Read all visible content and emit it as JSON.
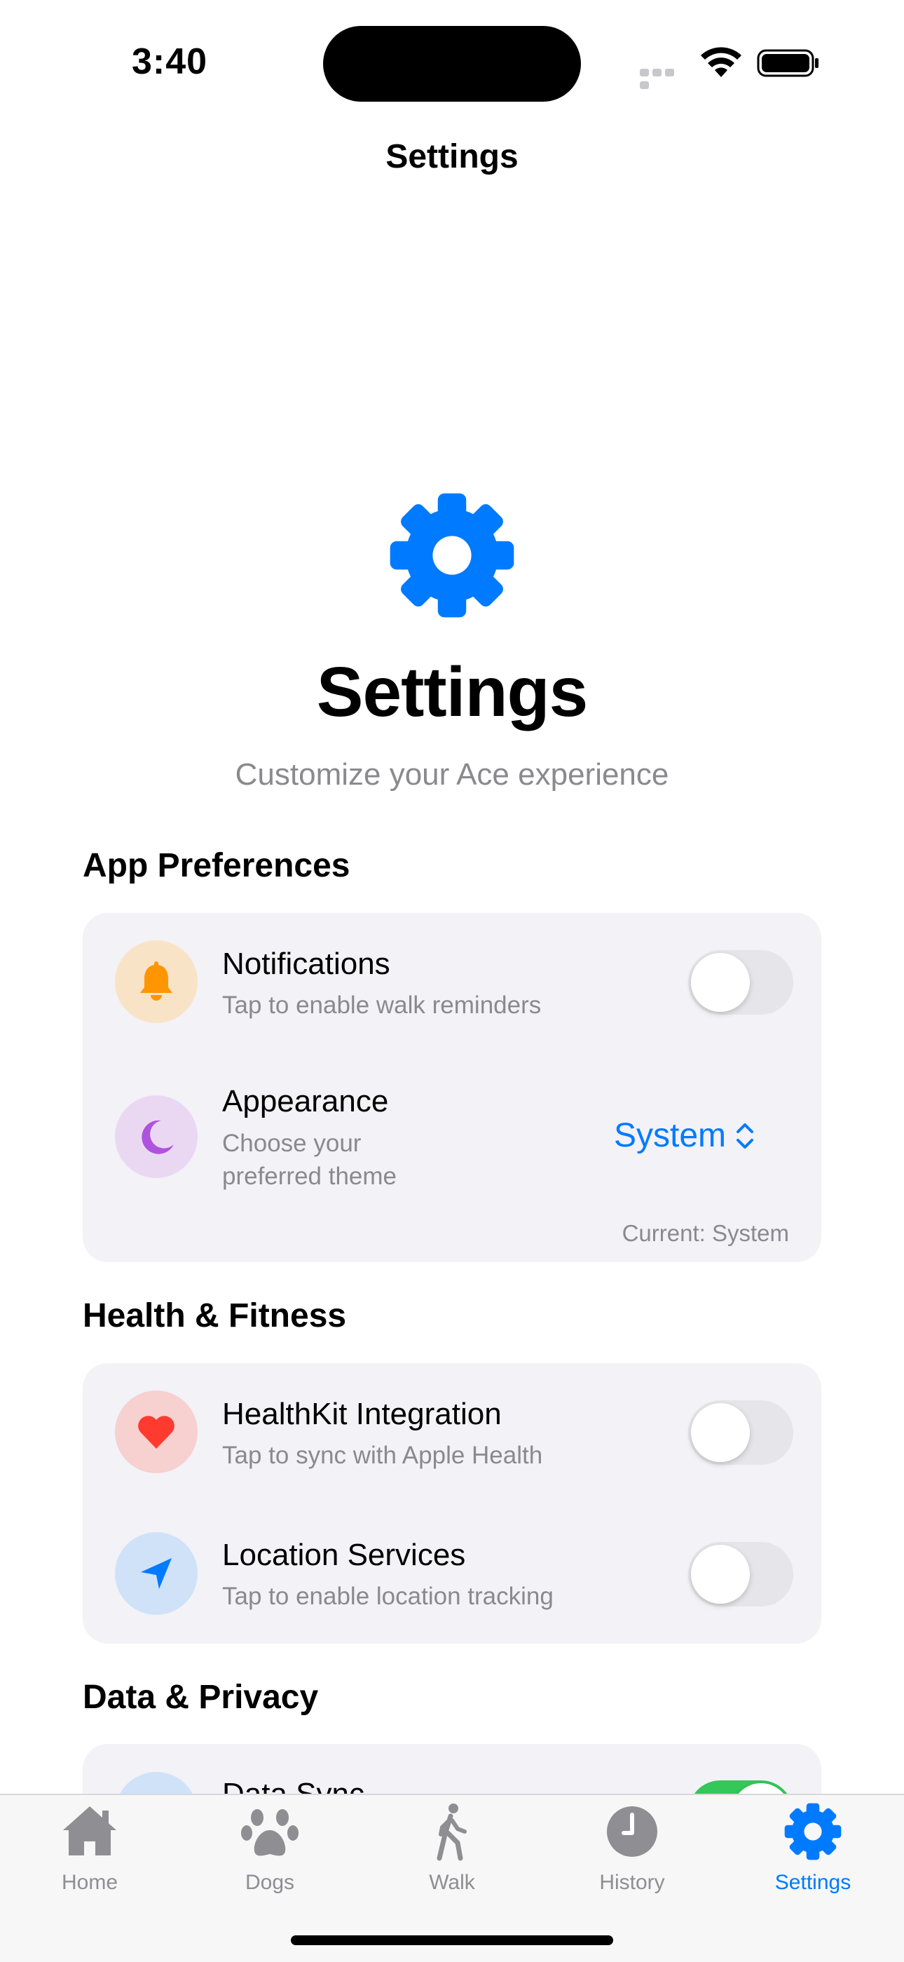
{
  "status_bar": {
    "time": "3:40"
  },
  "nav": {
    "title": "Settings"
  },
  "hero": {
    "icon": "gear-icon",
    "title": "Settings",
    "subtitle": "Customize your Ace experience"
  },
  "sections": [
    {
      "header": "App Preferences",
      "rows": [
        {
          "icon": "bell-icon",
          "title": "Notifications",
          "subtitle": "Tap to enable walk reminders",
          "toggle_on": false
        },
        {
          "icon": "moon-icon",
          "title": "Appearance",
          "subtitle_line1": "Choose your",
          "subtitle_line2": "preferred theme",
          "picker_value": "System",
          "current_note": "Current: System"
        }
      ]
    },
    {
      "header": "Health & Fitness",
      "rows": [
        {
          "icon": "heart-icon",
          "title": "HealthKit Integration",
          "subtitle": "Tap to sync with Apple Health",
          "toggle_on": false
        },
        {
          "icon": "location-arrow-icon",
          "title": "Location Services",
          "subtitle": "Tap to enable location tracking",
          "toggle_on": false
        }
      ]
    },
    {
      "header": "Data & Privacy",
      "rows": [
        {
          "icon": "sync-icon",
          "title": "Data Sync",
          "toggle_on": true
        }
      ]
    }
  ],
  "tab_bar": {
    "tabs": [
      {
        "label": "Home",
        "icon": "house-icon",
        "active": false
      },
      {
        "label": "Dogs",
        "icon": "paw-icon",
        "active": false
      },
      {
        "label": "Walk",
        "icon": "walking-figure-icon",
        "active": false
      },
      {
        "label": "History",
        "icon": "clock-icon",
        "active": false
      },
      {
        "label": "Settings",
        "icon": "gear-icon",
        "active": true
      }
    ]
  },
  "colors": {
    "accent": "#007aff",
    "card_background": "#f2f2f7",
    "secondary_text": "#8a8a8e",
    "toggle_off": "#e5e5ea",
    "toggle_on": "#34c759"
  }
}
